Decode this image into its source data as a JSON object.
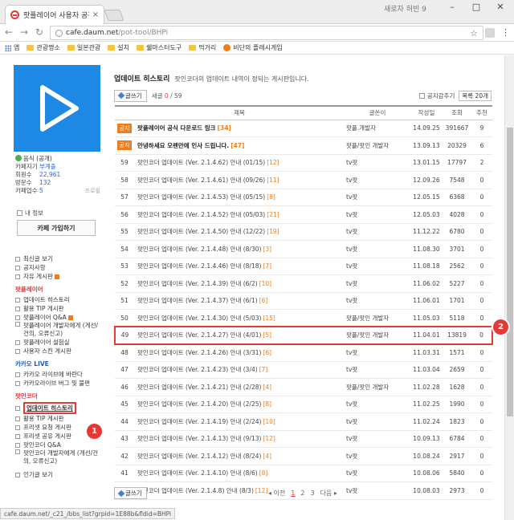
{
  "browser": {
    "tab_title": "팟플레이어 사용자 공간",
    "tab_close": "×",
    "window_user": "새로자 허빈 9",
    "url_host": "cafe.daum.net",
    "url_path": "/pot-tool/BHPi",
    "bookmarks": [
      "앱",
      "관광명소",
      "일본관광",
      "설치",
      "쉘마스터도구",
      "먹거리",
      "비단의 플레시게임"
    ],
    "status_url": "cafe.daum.net/_c21_/bbs_list?grpid=1E88b&fldid=BHPi"
  },
  "sidebar": {
    "cafe_level": "음식 (공개)",
    "info": [
      {
        "label": "카페지기",
        "value": "부계출",
        "extra": ""
      },
      {
        "label": "회원수",
        "value": "22,961",
        "extra": ""
      },
      {
        "label": "방문수",
        "value": "132",
        "extra": ""
      },
      {
        "label": "카페업수",
        "value": "5",
        "extra": "프로필"
      }
    ],
    "my_info": "내 정보",
    "join_button": "카페 가입하기",
    "menu_top": [
      "최신글 보기",
      "공지사항",
      "자유 게시판"
    ],
    "group1_title": "팟플레이어",
    "group1": [
      "업데이트 히스토리",
      "활용 TIP 게시판",
      "팟플레이어 Q&A",
      "팟플레이어 개발자에게 (게선/건의, 오류신고)",
      "팟플레이어 설험실",
      "사용자 스킨 게시판"
    ],
    "group2_title": "카카오 LIVE",
    "group2": [
      "카카오 라이브에 바란다",
      "카카오라이브 버그 및 불편"
    ],
    "group3_title": "팟인코더",
    "group3": [
      "업데이트 히스토리",
      "활용 TIP 게시판",
      "프리셋 요청 게시판",
      "프리셋 공유 게시판",
      "팟인코더 Q&A",
      "팟인코더 개발자에게 (개선/건의, 오류신고)"
    ],
    "menu_bottom": "인기글 보기"
  },
  "board": {
    "title": "업데이트 히스토리",
    "description": "팟인코더의 업데이트 내역이 정되는 게시판입니다.",
    "write_button": "글쓰기",
    "count_label": "새글",
    "count_new": "0",
    "count_total": "/ 59",
    "notice_toggle": "공지감추기",
    "list_select": "목록 20개",
    "columns": [
      "",
      "제목",
      "글쓴이",
      "작성일",
      "조회",
      "추천"
    ],
    "notice_tag": "공지",
    "rows": [
      {
        "num": "",
        "notice": true,
        "title": "팟플레이어 공식 다운로드 링크",
        "comments": "[34]",
        "bold": true,
        "author": "팟플.개발자",
        "date": "14.09.25",
        "views": "391667",
        "rec": "9"
      },
      {
        "num": "",
        "notice": true,
        "title": "안녕하세요 오렌만에 인사 드립니다.",
        "comments": "[47]",
        "bold": true,
        "author": "팟플/팟인 개발자",
        "date": "13.09.13",
        "views": "20329",
        "rec": "6"
      },
      {
        "num": "59",
        "notice": false,
        "title": "팟인코더 업데이트 (Ver. 2.1.4.62) 안내 (01/15)",
        "comments": "[12]",
        "bold": false,
        "author": "tv팟",
        "date": "13.01.15",
        "views": "17797",
        "rec": "2"
      },
      {
        "num": "58",
        "notice": false,
        "title": "팟인코더 업데이트 (Ver. 2.1.4.61) 안내 (09/26)",
        "comments": "[11]",
        "bold": false,
        "author": "tv팟",
        "date": "12.09.26",
        "views": "7548",
        "rec": "0"
      },
      {
        "num": "57",
        "notice": false,
        "title": "팟인코더 업데이트 (Ver. 2.1.4.53) 안내 (05/15)",
        "comments": "[8]",
        "bold": false,
        "author": "tv팟",
        "date": "12.05.15",
        "views": "6368",
        "rec": "0"
      },
      {
        "num": "56",
        "notice": false,
        "title": "팟인코더 업데이트 (Ver. 2.1.4.52) 안내 (05/03)",
        "comments": "[21]",
        "bold": false,
        "author": "tv팟",
        "date": "12.05.03",
        "views": "4028",
        "rec": "0"
      },
      {
        "num": "55",
        "notice": false,
        "title": "팟인코더 업데이트 (Ver. 2.1.4.50) 안내 (12/22)",
        "comments": "[19]",
        "bold": false,
        "author": "tv팟",
        "date": "11.12.22",
        "views": "6780",
        "rec": "0"
      },
      {
        "num": "54",
        "notice": false,
        "title": "팟인코더 업데이트 (Ver. 2.1.4.48) 안내 (8/30)",
        "comments": "[3]",
        "bold": false,
        "author": "tv팟",
        "date": "11.08.30",
        "views": "3701",
        "rec": "0"
      },
      {
        "num": "53",
        "notice": false,
        "title": "팟인코더 업데이트 (Ver. 2.1.4.46) 안내 (8/18)",
        "comments": "[7]",
        "bold": false,
        "author": "tv팟",
        "date": "11.08.18",
        "views": "2562",
        "rec": "0"
      },
      {
        "num": "52",
        "notice": false,
        "title": "팟인코더 업데이트 (Ver. 2.1.4.39) 안내 (6/2)",
        "comments": "[10]",
        "bold": false,
        "author": "tv팟",
        "date": "11.06.02",
        "views": "5227",
        "rec": "0"
      },
      {
        "num": "51",
        "notice": false,
        "title": "팟인코더 업데이트 (Ver. 2.1.4.37) 안내 (6/1)",
        "comments": "[6]",
        "bold": false,
        "author": "tv팟",
        "date": "11.06.01",
        "views": "1701",
        "rec": "0"
      },
      {
        "num": "50",
        "notice": false,
        "title": "팟인코더 업데이트 (Ver. 2.1.4.30) 안내 (5/03)",
        "comments": "[15]",
        "bold": false,
        "author": "팟플/팟인 개발자",
        "date": "11.05.03",
        "views": "5118",
        "rec": "0"
      },
      {
        "num": "49",
        "notice": false,
        "title": "팟인코더 업데이트 (Ver. 2.1.4.27) 안내 (4/01)",
        "comments": "[5]",
        "bold": false,
        "author": "팟플/팟인 개발자",
        "date": "11.04.01",
        "views": "13819",
        "rec": "0",
        "highlight": true
      },
      {
        "num": "48",
        "notice": false,
        "title": "팟인코더 업데이트 (Ver. 2.1.4.26) 안내 (3/31)",
        "comments": "[6]",
        "bold": false,
        "author": "tv팟",
        "date": "11.03.31",
        "views": "1571",
        "rec": "0"
      },
      {
        "num": "47",
        "notice": false,
        "title": "팟인코더 업데이트 (Ver. 2.1.4.23) 안내 (3/4)",
        "comments": "[7]",
        "bold": false,
        "author": "tv팟",
        "date": "11.03.04",
        "views": "2659",
        "rec": "0"
      },
      {
        "num": "46",
        "notice": false,
        "title": "팟인코더 업데이트 (Ver. 2.1.4.21) 안내 (2/28)",
        "comments": "[4]",
        "bold": false,
        "author": "팟플/팟인 개발자",
        "date": "11.02.28",
        "views": "1628",
        "rec": "0"
      },
      {
        "num": "45",
        "notice": false,
        "title": "팟인코더 업데이트 (Ver. 2.1.4.20) 안내 (2/25)",
        "comments": "[8]",
        "bold": false,
        "author": "tv팟",
        "date": "11.02.25",
        "views": "1990",
        "rec": "0"
      },
      {
        "num": "44",
        "notice": false,
        "title": "팟인코더 업데이트 (Ver. 2.1.4.19) 안내 (2/24)",
        "comments": "[10]",
        "bold": false,
        "author": "tv팟",
        "date": "11.02.24",
        "views": "1823",
        "rec": "0"
      },
      {
        "num": "43",
        "notice": false,
        "title": "팟인코더 업데이트 (Ver. 2.1.4.13) 안내 (9/13)",
        "comments": "[12]",
        "bold": false,
        "author": "tv팟",
        "date": "10.09.13",
        "views": "6784",
        "rec": "0"
      },
      {
        "num": "42",
        "notice": false,
        "title": "팟인코더 업데이트 (Ver. 2.1.4.12) 안내 (8/24)",
        "comments": "[4]",
        "bold": false,
        "author": "tv팟",
        "date": "10.08.24",
        "views": "2917",
        "rec": "0"
      },
      {
        "num": "41",
        "notice": false,
        "title": "팟인코더 업데이트 (Ver. 2.1.4.10) 안내 (8/6)",
        "comments": "[8]",
        "bold": false,
        "author": "tv팟",
        "date": "10.08.06",
        "views": "5840",
        "rec": "0"
      },
      {
        "num": "40",
        "notice": false,
        "title": "팟인코더 업데이트 (Ver. 2.1.4.8) 안내 (8/3)",
        "comments": "[12]",
        "bold": false,
        "author": "tv팟",
        "date": "10.08.03",
        "views": "2973",
        "rec": "0"
      }
    ],
    "pager": {
      "prev": "◂ 이전",
      "pages": [
        "1",
        "2",
        "3"
      ],
      "current": "1",
      "next": "다음 ▸"
    }
  },
  "annotations": [
    "1",
    "2"
  ],
  "colors": {
    "accent": "#e53935",
    "logo_bg": "#1e88e5",
    "notice_tag": "#f07d1a"
  }
}
